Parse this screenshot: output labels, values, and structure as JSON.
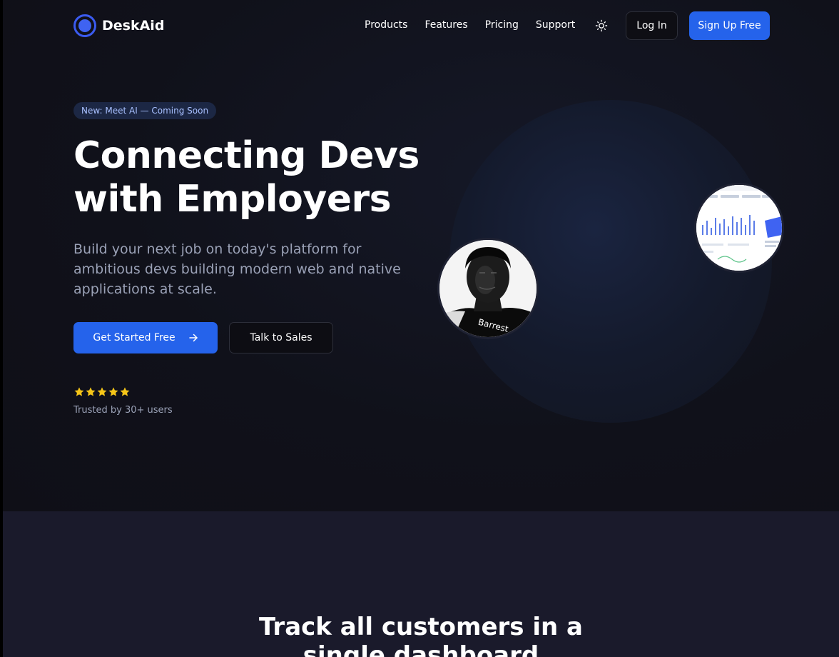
{
  "brand": {
    "name": "DeskAid",
    "accent": "#2563eb"
  },
  "nav": {
    "links": [
      "Products",
      "Features",
      "Pricing",
      "Support"
    ],
    "theme_icon": "sun-icon",
    "login_label": "Log In",
    "signup_label": "Sign Up Free"
  },
  "hero": {
    "badge": "New: Meet AI — Coming Soon",
    "title_line1": "Connecting Devs",
    "title_line2": "with Employers",
    "subtitle": "Build your next job on today's platform for ambitious devs building modern web and native applications at scale.",
    "cta_primary": "Get Started Free",
    "cta_primary_icon": "arrow-right-icon",
    "cta_secondary": "Talk to Sales",
    "rating_stars": 5,
    "rating_color": "#f5c518",
    "trusted_text": "Trusted by 30+ users",
    "avatar_label": "Barrest"
  },
  "section2": {
    "title_line1": "Track all customers in a",
    "title_line2": "single dashboard"
  }
}
